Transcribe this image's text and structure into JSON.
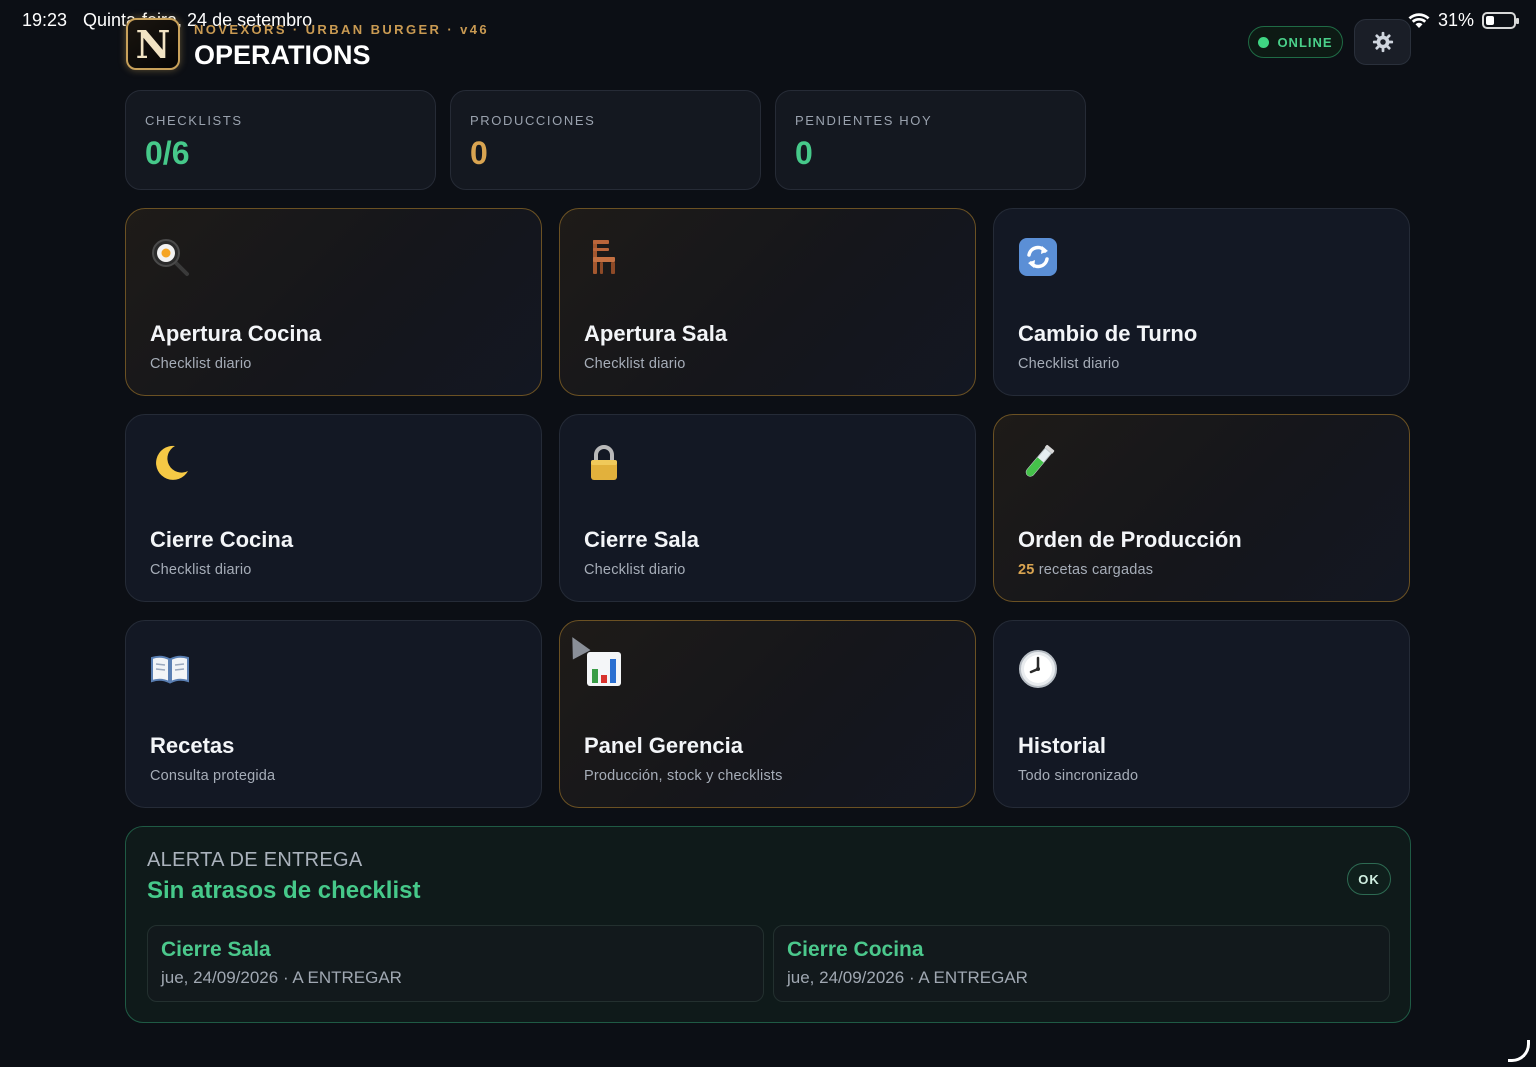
{
  "status_bar": {
    "time": "19:23",
    "date": "Quinta-feira, 24 de setembro",
    "battery": "31%",
    "battery_level": 0.31
  },
  "header": {
    "logo_letter": "N",
    "brand_line": "NOVEXORS · URBAN BURGER · v46",
    "title": "OPERATIONS",
    "online_label": "ONLINE",
    "settings_icon": "gear-icon"
  },
  "stats": [
    {
      "label": "CHECKLISTS",
      "value": "0/6",
      "color": "#46c98a"
    },
    {
      "label": "PRODUCCIONES",
      "value": "0",
      "color": "#d9a451"
    },
    {
      "label": "PENDIENTES HOY",
      "value": "0",
      "color": "#46c98a"
    }
  ],
  "tiles": [
    {
      "title": "Apertura Cocina",
      "subtitle": "Checklist diario",
      "icon": "frying-pan-icon",
      "accent": "gold"
    },
    {
      "title": "Apertura Sala",
      "subtitle": "Checklist diario",
      "icon": "chair-icon",
      "accent": "gold"
    },
    {
      "title": "Cambio de Turno",
      "subtitle": "Checklist diario",
      "icon": "refresh-icon",
      "accent": "none"
    },
    {
      "title": "Cierre Cocina",
      "subtitle": "Checklist diario",
      "icon": "crescent-moon-icon",
      "accent": "none"
    },
    {
      "title": "Cierre Sala",
      "subtitle": "Checklist diario",
      "icon": "lock-icon",
      "accent": "none"
    },
    {
      "title": "Orden de Producción",
      "subtitle_count": "25",
      "subtitle": "recetas cargadas",
      "icon": "test-tube-icon",
      "accent": "gold"
    },
    {
      "title": "Recetas",
      "subtitle": "Consulta protegida",
      "icon": "open-book-icon",
      "accent": "none"
    },
    {
      "title": "Panel Gerencia",
      "subtitle": "Producción, stock y checklists",
      "icon": "bar-chart-icon",
      "accent": "gold"
    },
    {
      "title": "Historial",
      "subtitle": "Todo sincronizado",
      "icon": "clock-icon",
      "accent": "none"
    }
  ],
  "alert": {
    "label": "ALERTA DE ENTREGA",
    "title": "Sin atrasos de checklist",
    "ok_label": "OK",
    "items": [
      {
        "name": "Cierre Sala",
        "meta": "jue, 24/09/2026 · A ENTREGAR"
      },
      {
        "name": "Cierre Cocina",
        "meta": "jue, 24/09/2026 · A ENTREGAR"
      }
    ]
  },
  "colors": {
    "background": "#0c0f15",
    "green_accent": "#46c98a",
    "gold_accent": "#d9a451",
    "tile_border_gold": "#6b5123"
  }
}
